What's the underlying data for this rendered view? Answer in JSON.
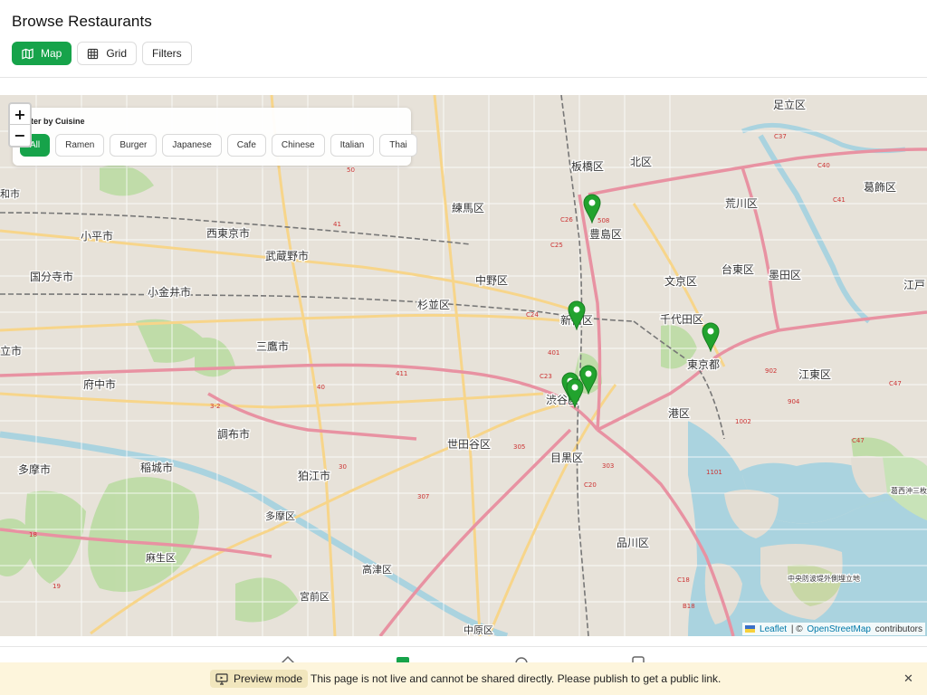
{
  "page": {
    "title": "Browse Restaurants"
  },
  "view_toggle": {
    "map_label": "Map",
    "grid_label": "Grid",
    "filters_label": "Filters",
    "active": "Map",
    "accent_color": "#16a34a"
  },
  "map": {
    "zoom_in": "+",
    "zoom_out": "−",
    "filter_panel": {
      "title": "Filter by Cuisine",
      "visible_title": "ter by Cuisine",
      "selected": "All",
      "options": [
        "All",
        "Ramen",
        "Burger",
        "Japanese",
        "Cafe",
        "Chinese",
        "Italian",
        "Thai"
      ]
    },
    "place_labels": [
      "足立区",
      "北区",
      "板橋区",
      "葛飾区",
      "荒川区",
      "練馬区",
      "豊島区",
      "西東京市",
      "小平市",
      "武蔵野市",
      "台東区",
      "墨田区",
      "国分寺市",
      "小金井市",
      "中野区",
      "文京区",
      "杉並区",
      "江戸",
      "新宿区",
      "千代田区",
      "立市",
      "三鷹市",
      "東京都",
      "江東区",
      "府中市",
      "渋谷区",
      "港区",
      "調布市",
      "世田谷区",
      "多摩市",
      "稲城市",
      "狛江市",
      "目黒区",
      "多摩区",
      "品川区",
      "麻生区",
      "高津区",
      "宮前区",
      "中原区",
      "和市",
      "葛西沖三枚洲",
      "中央防波堤外側埋立地"
    ],
    "attribution": {
      "leaflet": "Leaflet",
      "separator": " | © ",
      "osm": "OpenStreetMap",
      "suffix": " contributors"
    },
    "marker_color": "#22a32e",
    "marker_count": 6
  },
  "preview_bar": {
    "badge": "Preview mode",
    "message": "This page is not live and cannot be shared directly. Please publish to get a public link.",
    "close": "✕",
    "background": "#fdf5dc"
  },
  "icons": {
    "map": "map-icon",
    "grid": "grid-icon",
    "preview": "monitor-icon",
    "close": "close-icon",
    "marker": "map-marker-icon"
  }
}
